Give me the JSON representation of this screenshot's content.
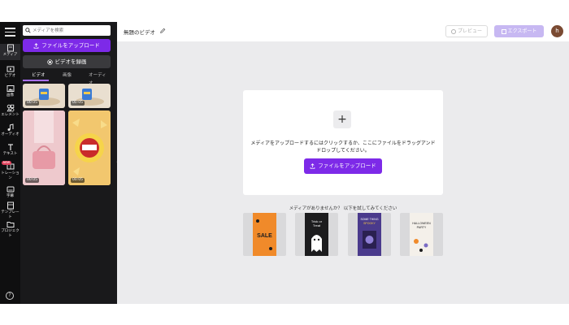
{
  "rail": {
    "items": [
      {
        "label": "メディア",
        "icon": "media-icon"
      },
      {
        "label": "ビデオ",
        "icon": "video-icon"
      },
      {
        "label": "画像",
        "icon": "image-icon"
      },
      {
        "label": "エレメント",
        "icon": "elements-icon"
      },
      {
        "label": "オーディオ",
        "icon": "audio-icon"
      },
      {
        "label": "テキスト",
        "icon": "text-icon"
      },
      {
        "label": "トレーショ\nン",
        "icon": "transition-icon"
      },
      {
        "label": "字幕",
        "icon": "captions-icon"
      },
      {
        "label": "テンプレー\nト",
        "icon": "templates-icon"
      },
      {
        "label": "プロジェク\nト",
        "icon": "folder-icon"
      }
    ],
    "help": "?"
  },
  "panel": {
    "search_placeholder": "メディアを検索",
    "upload_label": "ファイルをアップロード",
    "record_label": "ビデオを録画",
    "tabs": [
      "ビデオ",
      "画像",
      "オーディオ"
    ],
    "media": [
      {
        "duration": "00:05"
      },
      {
        "duration": "00:05"
      },
      {
        "duration": "00:05"
      },
      {
        "duration": "00:05"
      }
    ]
  },
  "topbar": {
    "title": "無題のビデオ",
    "preview_label": "プレビュー",
    "export_label": "エクスポート",
    "avatar_initial": "h"
  },
  "main": {
    "drop_text": "メディアをアップロードするにはクリックするか、ここにファイルをドラッグアンドドロップしてください。",
    "upload_button": "ファイルをアップロード",
    "suggest_text": "メディアがありませんか？ 以下を試してみてください",
    "templates": [
      {
        "title": "SALE",
        "color": "#f08a2a"
      },
      {
        "title": "Trick or Treat",
        "color": "#1c1c1e"
      },
      {
        "title": "SOME THING SPOOKY",
        "color": "#4a3a8c"
      },
      {
        "title": "HALLOWEEN PARTY",
        "color": "#f4f0ea"
      }
    ]
  },
  "colors": {
    "accent": "#7d2ae8",
    "export_disabled": "#c7b8f2"
  }
}
